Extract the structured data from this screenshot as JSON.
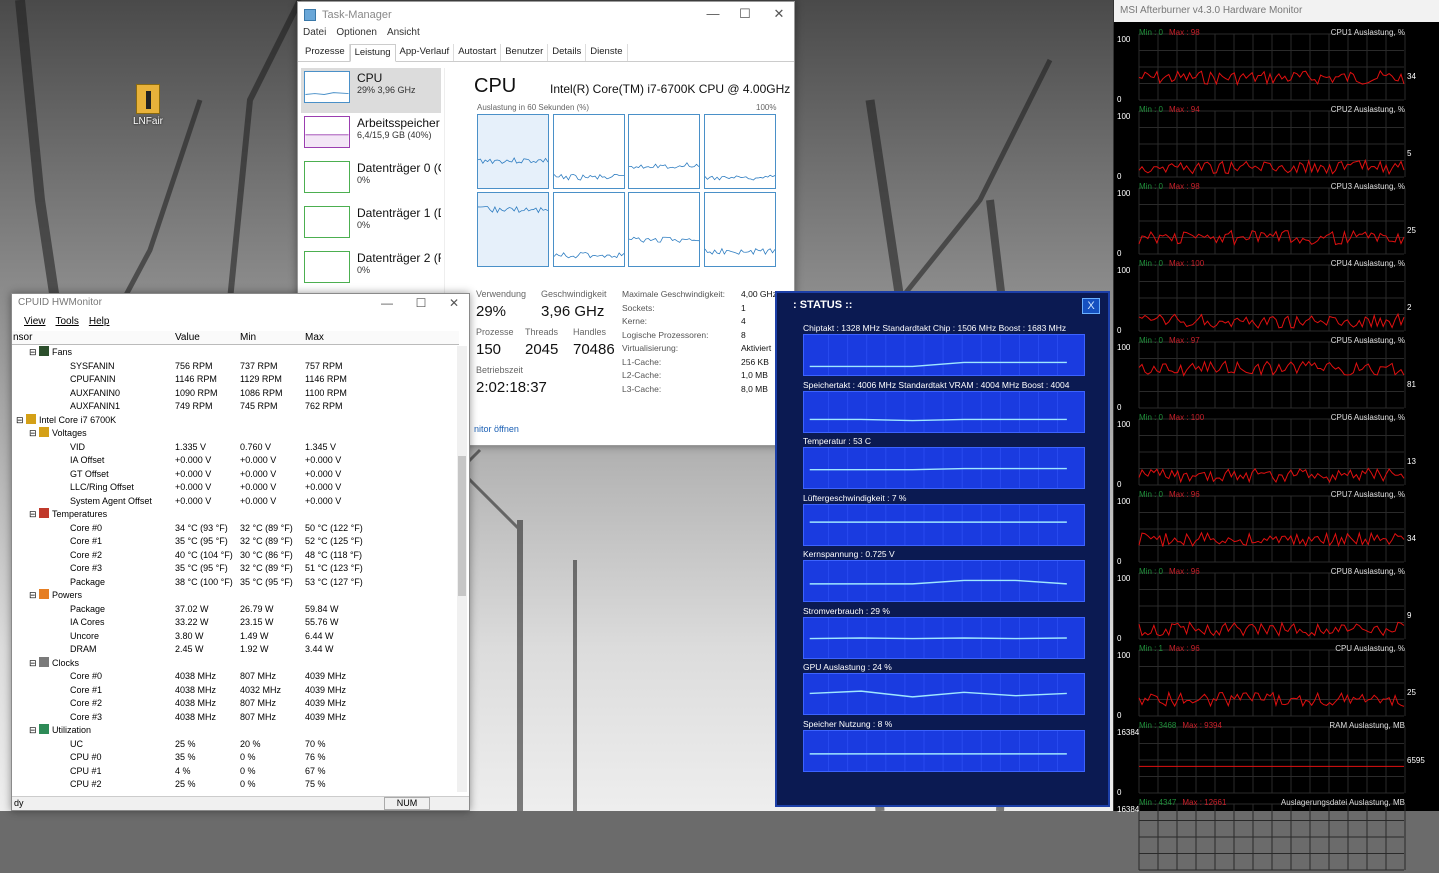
{
  "desktop": {
    "icon_label": "LNFair"
  },
  "taskmanager": {
    "title": "Task-Manager",
    "menus": [
      "Datei",
      "Optionen",
      "Ansicht"
    ],
    "tabs": [
      "Prozesse",
      "Leistung",
      "App-Verlauf",
      "Autostart",
      "Benutzer",
      "Details",
      "Dienste"
    ],
    "sidebar": [
      {
        "name": "CPU",
        "sub": "29% 3,96 GHz"
      },
      {
        "name": "Arbeitsspeicher",
        "sub": "6,4/15,9 GB (40%)"
      },
      {
        "name": "Datenträger 0 (C",
        "sub": "0%"
      },
      {
        "name": "Datenträger 1 (D",
        "sub": "0%"
      },
      {
        "name": "Datenträger 2 (F",
        "sub": "0%"
      }
    ],
    "heading": "CPU",
    "model": "Intel(R) Core(TM) i7-6700K CPU @ 4.00GHz",
    "axis_label": "Auslastung in 60 Sekunden (%)",
    "axis_max": "100%",
    "stats": {
      "verwendung_label": "Verwendung",
      "verwendung": "29%",
      "geschw_label": "Geschwindigkeit",
      "geschw": "3,96 GHz",
      "prozesse_label": "Prozesse",
      "prozesse": "150",
      "threads_label": "Threads",
      "threads": "2045",
      "handles_label": "Handles",
      "handles": "70486",
      "betrieb_label": "Betriebszeit",
      "betrieb": "2:02:18:37"
    },
    "specs": [
      {
        "k": "Maximale Geschwindigkeit:",
        "v": "4,00 GHz"
      },
      {
        "k": "Sockets:",
        "v": "1"
      },
      {
        "k": "Kerne:",
        "v": "4"
      },
      {
        "k": "Logische Prozessoren:",
        "v": "8"
      },
      {
        "k": "Virtualisierung:",
        "v": "Aktiviert"
      },
      {
        "k": "L1-Cache:",
        "v": "256 KB"
      },
      {
        "k": "L2-Cache:",
        "v": "1,0 MB"
      },
      {
        "k": "L3-Cache:",
        "v": "8,0 MB"
      }
    ],
    "link": "nitor öffnen"
  },
  "hwmonitor": {
    "title": "CPUID HWMonitor",
    "menus": [
      "View",
      "Tools",
      "Help"
    ],
    "headers": [
      "nsor",
      "Value",
      "Min",
      "Max"
    ],
    "rows": [
      {
        "lvl": 2,
        "name": "Fans",
        "icon": "fan-icon"
      },
      {
        "lvl": 3,
        "name": "SYSFANIN",
        "v": "756 RPM",
        "mn": "737 RPM",
        "mx": "757 RPM"
      },
      {
        "lvl": 3,
        "name": "CPUFANIN",
        "v": "1146 RPM",
        "mn": "1129 RPM",
        "mx": "1146 RPM"
      },
      {
        "lvl": 3,
        "name": "AUXFANIN0",
        "v": "1090 RPM",
        "mn": "1086 RPM",
        "mx": "1100 RPM"
      },
      {
        "lvl": 3,
        "name": "AUXFANIN1",
        "v": "749 RPM",
        "mn": "745 RPM",
        "mx": "762 RPM"
      },
      {
        "lvl": 1,
        "name": "Intel Core i7 6700K",
        "icon": "chip-icon"
      },
      {
        "lvl": 2,
        "name": "Voltages",
        "icon": "voltage-icon"
      },
      {
        "lvl": 3,
        "name": "VID",
        "v": "1.335 V",
        "mn": "0.760 V",
        "mx": "1.345 V"
      },
      {
        "lvl": 3,
        "name": "IA Offset",
        "v": "+0.000 V",
        "mn": "+0.000 V",
        "mx": "+0.000 V"
      },
      {
        "lvl": 3,
        "name": "GT Offset",
        "v": "+0.000 V",
        "mn": "+0.000 V",
        "mx": "+0.000 V"
      },
      {
        "lvl": 3,
        "name": "LLC/Ring Offset",
        "v": "+0.000 V",
        "mn": "+0.000 V",
        "mx": "+0.000 V"
      },
      {
        "lvl": 3,
        "name": "System Agent Offset",
        "v": "+0.000 V",
        "mn": "+0.000 V",
        "mx": "+0.000 V"
      },
      {
        "lvl": 2,
        "name": "Temperatures",
        "icon": "thermometer-icon"
      },
      {
        "lvl": 3,
        "name": "Core #0",
        "v": "34 °C  (93 °F)",
        "mn": "32 °C  (89 °F)",
        "mx": "50 °C  (122 °F)"
      },
      {
        "lvl": 3,
        "name": "Core #1",
        "v": "35 °C  (95 °F)",
        "mn": "32 °C  (89 °F)",
        "mx": "52 °C  (125 °F)"
      },
      {
        "lvl": 3,
        "name": "Core #2",
        "v": "40 °C  (104 °F)",
        "mn": "30 °C  (86 °F)",
        "mx": "48 °C  (118 °F)"
      },
      {
        "lvl": 3,
        "name": "Core #3",
        "v": "35 °C  (95 °F)",
        "mn": "32 °C  (89 °F)",
        "mx": "51 °C  (123 °F)"
      },
      {
        "lvl": 3,
        "name": "Package",
        "v": "38 °C  (100 °F)",
        "mn": "35 °C  (95 °F)",
        "mx": "53 °C  (127 °F)"
      },
      {
        "lvl": 2,
        "name": "Powers",
        "icon": "power-icon"
      },
      {
        "lvl": 3,
        "name": "Package",
        "v": "37.02 W",
        "mn": "26.79 W",
        "mx": "59.84 W"
      },
      {
        "lvl": 3,
        "name": "IA Cores",
        "v": "33.22 W",
        "mn": "23.15 W",
        "mx": "55.76 W"
      },
      {
        "lvl": 3,
        "name": "Uncore",
        "v": "3.80 W",
        "mn": "1.49 W",
        "mx": "6.44 W"
      },
      {
        "lvl": 3,
        "name": "DRAM",
        "v": "2.45 W",
        "mn": "1.92 W",
        "mx": "3.44 W"
      },
      {
        "lvl": 2,
        "name": "Clocks",
        "icon": "clock-icon"
      },
      {
        "lvl": 3,
        "name": "Core #0",
        "v": "4038 MHz",
        "mn": "807 MHz",
        "mx": "4039 MHz"
      },
      {
        "lvl": 3,
        "name": "Core #1",
        "v": "4038 MHz",
        "mn": "4032 MHz",
        "mx": "4039 MHz"
      },
      {
        "lvl": 3,
        "name": "Core #2",
        "v": "4038 MHz",
        "mn": "807 MHz",
        "mx": "4039 MHz"
      },
      {
        "lvl": 3,
        "name": "Core #3",
        "v": "4038 MHz",
        "mn": "807 MHz",
        "mx": "4039 MHz"
      },
      {
        "lvl": 2,
        "name": "Utilization",
        "icon": "utilization-icon"
      },
      {
        "lvl": 3,
        "name": "UC",
        "v": "25 %",
        "mn": "20 %",
        "mx": "70 %"
      },
      {
        "lvl": 3,
        "name": "CPU #0",
        "v": "35 %",
        "mn": "0 %",
        "mx": "76 %"
      },
      {
        "lvl": 3,
        "name": "CPU #1",
        "v": "4 %",
        "mn": "0 %",
        "mx": "67 %"
      },
      {
        "lvl": 3,
        "name": "CPU #2",
        "v": "25 %",
        "mn": "0 %",
        "mx": "75 %"
      }
    ],
    "status_left": "dy",
    "status_num": "NUM"
  },
  "gpu_status": {
    "title": ": STATUS ::",
    "close": "X",
    "rows": [
      "Chiptakt : 1328 MHz     Standardtakt Chip : 1506 MHz   Boost : 1683 MHz",
      "Speichertakt : 4006 MHz     Standardtakt VRAM : 4004 MHz   Boost : 4004",
      "Temperatur : 53 C",
      "Lüftergeschwindigkeit : 7 %",
      "Kernspannung : 0.725 V",
      "Stromverbrauch : 29 %",
      "GPU Auslastung : 24 %",
      "Speicher Nutzung : 8 %"
    ]
  },
  "afterburner": {
    "title": "MSI Afterburner v4.3.0 Hardware Monitor",
    "panels": [
      {
        "name": "CPU1 Auslastung, %",
        "min": "Min : 0",
        "max": "Max : 98",
        "cur": "34",
        "top": "100",
        "bottom": "0"
      },
      {
        "name": "CPU2 Auslastung, %",
        "min": "Min : 0",
        "max": "Max : 94",
        "cur": "5",
        "top": "100",
        "bottom": "0"
      },
      {
        "name": "CPU3 Auslastung, %",
        "min": "Min : 0",
        "max": "Max : 98",
        "cur": "25",
        "top": "100",
        "bottom": "0"
      },
      {
        "name": "CPU4 Auslastung, %",
        "min": "Min : 0",
        "max": "Max : 100",
        "cur": "2",
        "top": "100",
        "bottom": "0"
      },
      {
        "name": "CPU5 Auslastung, %",
        "min": "Min : 0",
        "max": "Max : 97",
        "cur": "81",
        "top": "100",
        "bottom": "0"
      },
      {
        "name": "CPU6 Auslastung, %",
        "min": "Min : 0",
        "max": "Max : 100",
        "cur": "13",
        "top": "100",
        "bottom": "0"
      },
      {
        "name": "CPU7 Auslastung, %",
        "min": "Min : 0",
        "max": "Max : 96",
        "cur": "34",
        "top": "100",
        "bottom": "0"
      },
      {
        "name": "CPU8 Auslastung, %",
        "min": "Min : 0",
        "max": "Max : 96",
        "cur": "9",
        "top": "100",
        "bottom": "0"
      },
      {
        "name": "CPU Auslastung, %",
        "min": "Min : 1",
        "max": "Max : 96",
        "cur": "25",
        "top": "100",
        "bottom": "0"
      },
      {
        "name": "RAM Auslastung, MB",
        "min": "Min : 3468",
        "max": "Max : 9394",
        "cur": "6595",
        "top": "16384",
        "bottom": "0"
      },
      {
        "name": "Auslagerungsdatei Auslastung, MB",
        "min": "Min : 4347",
        "max": "Max : 12661",
        "cur": "",
        "top": "16384",
        "bottom": ""
      }
    ]
  }
}
